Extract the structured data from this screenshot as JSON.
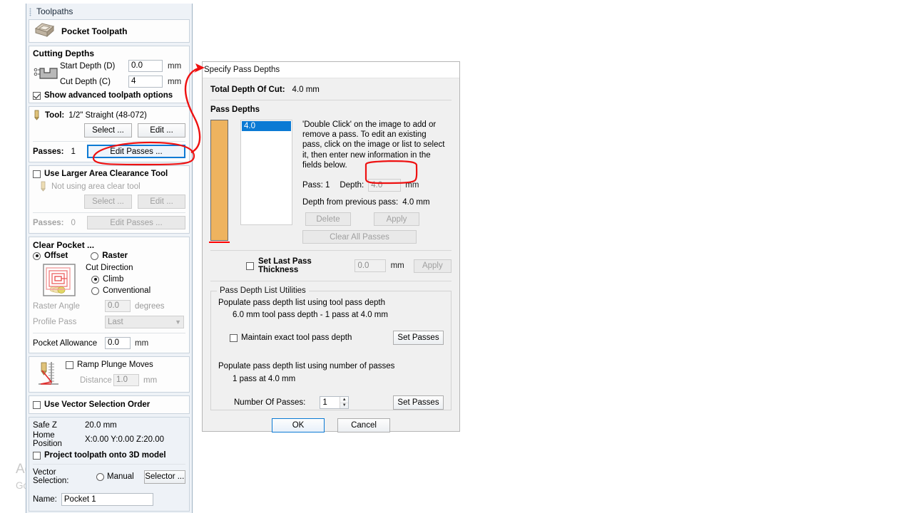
{
  "panel": {
    "title": "Toolpaths",
    "header": {
      "icon": "pocket-toolpath-icon",
      "label": "Pocket Toolpath"
    },
    "cutting_depths": {
      "title": "Cutting Depths",
      "icon": "cut-depth-profile-icon",
      "start_depth_label": "Start Depth (D)",
      "start_depth_value": "0.0",
      "start_depth_unit": "mm",
      "cut_depth_label": "Cut Depth (C)",
      "cut_depth_value": "4",
      "cut_depth_unit": "mm",
      "advanced_label": "Show advanced toolpath options",
      "advanced_checked": true
    },
    "tool": {
      "icon": "end-mill-icon",
      "label": "Tool:",
      "value": "1/2\" Straight  (48-072)",
      "select_label": "Select ...",
      "edit_label": "Edit ...",
      "passes_label": "Passes:",
      "passes_value": "1",
      "edit_passes_label": "Edit Passes ..."
    },
    "area_clear": {
      "checkbox_label": "Use Larger Area Clearance Tool",
      "checked": false,
      "icon": "end-mill-icon",
      "not_using_text": "Not using area clear tool",
      "select_label": "Select ...",
      "edit_label": "Edit ...",
      "passes_label": "Passes:",
      "passes_value": "0",
      "edit_passes_label": "Edit Passes ..."
    },
    "clear_pocket": {
      "title": "Clear Pocket ...",
      "offset_label": "Offset",
      "offset_selected": true,
      "raster_label": "Raster",
      "raster_selected": false,
      "preview_icon": "offset-pocket-preview-icon",
      "cut_direction_label": "Cut Direction",
      "climb_label": "Climb",
      "climb_selected": true,
      "conventional_label": "Conventional",
      "conventional_selected": false,
      "raster_angle_label": "Raster Angle",
      "raster_angle_value": "0.0",
      "raster_angle_unit": "degrees",
      "profile_pass_label": "Profile Pass",
      "profile_pass_value": "Last",
      "pocket_allowance_label": "Pocket Allowance",
      "pocket_allowance_value": "0.0",
      "pocket_allowance_unit": "mm"
    },
    "ramp": {
      "icon": "ramp-plunge-icon",
      "checkbox_label": "Ramp Plunge Moves",
      "checked": false,
      "distance_label": "Distance",
      "distance_value": "1.0",
      "distance_unit": "mm"
    },
    "vector_order": {
      "checkbox_label": "Use Vector Selection Order",
      "checked": false
    },
    "footer": {
      "safe_z_label": "Safe Z",
      "safe_z_value": "20.0 mm",
      "home_position_label": "Home Position",
      "home_position_value": "X:0.00 Y:0.00 Z:20.00",
      "project_label": "Project toolpath onto 3D model",
      "project_checked": false,
      "vector_selection_label": "Vector Selection:",
      "manual_label": "Manual",
      "manual_selected": false,
      "selector_label": "Selector ...",
      "name_label": "Name:",
      "name_value": "Pocket 1"
    }
  },
  "dialog": {
    "title": "Specify Pass Depths",
    "total_depth_label": "Total Depth Of Cut:",
    "total_depth_value": "4.0 mm",
    "pass_depths_label": "Pass Depths",
    "pass_list": [
      "4.0"
    ],
    "help_text": "'Double Click' on the image to add or remove a pass. To edit an existing pass, click on the image or list to select it, then enter new information in the fields below.",
    "pass_label": "Pass: 1",
    "depth_label": "Depth:",
    "depth_value": "4.0",
    "depth_unit": "mm",
    "depth_prev_label": "Depth from previous pass:",
    "depth_prev_value": "4.0 mm",
    "delete_label": "Delete",
    "apply_label": "Apply",
    "clear_all_label": "Clear All Passes",
    "last_pass_label": "Set Last Pass Thickness",
    "last_pass_checked": false,
    "last_pass_value": "0.0",
    "last_pass_unit": "mm",
    "last_pass_apply_label": "Apply",
    "utilities": {
      "group_title": "Pass Depth List Utilities",
      "populate_tool_label": "Populate pass depth list using tool pass depth",
      "tool_pass_summary": "6.0 mm tool pass depth - 1 pass at 4.0 mm",
      "maintain_label": "Maintain exact tool pass depth",
      "maintain_checked": false,
      "set_passes_label_1": "Set Passes",
      "populate_number_label": "Populate pass depth list using number of passes",
      "number_summary": "1 pass at 4.0 mm",
      "number_of_passes_label": "Number Of Passes:",
      "number_of_passes_value": "1",
      "set_passes_label_2": "Set Passes"
    },
    "ok_label": "OK",
    "cancel_label": "Cancel"
  },
  "watermark": {
    "line1": "Activate Windows",
    "line2": "Go to Settings to activate Windows."
  },
  "annotation": {
    "color": "#ee1111",
    "description": "hand-drawn arrow from Edit Passes button to dialog title"
  }
}
